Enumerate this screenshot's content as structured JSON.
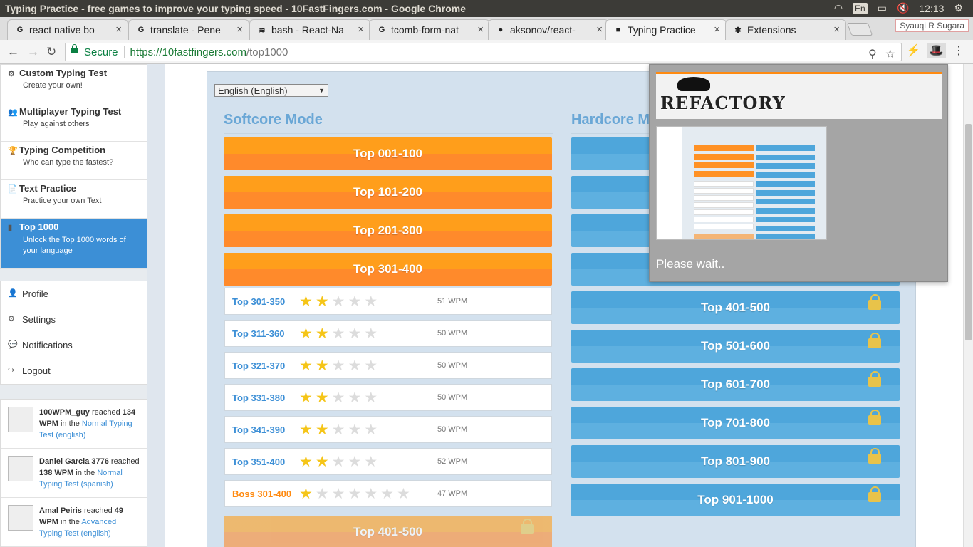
{
  "os": {
    "title": "Typing Practice - free games to improve your typing speed - 10FastFingers.com - Google Chrome",
    "lang": "En",
    "time": "12:13"
  },
  "tabs": [
    {
      "label": "react native bo",
      "fav": "G"
    },
    {
      "label": "translate - Pene",
      "fav": "G"
    },
    {
      "label": "bash - React-Na",
      "fav": "≋"
    },
    {
      "label": "tcomb-form-nat",
      "fav": "G"
    },
    {
      "label": "aksonov/react-",
      "fav": "●"
    },
    {
      "label": "Typing Practice",
      "fav": "■"
    },
    {
      "label": "Extensions",
      "fav": "✱"
    }
  ],
  "tab_close": "×",
  "user": "Syauqi R Sugara",
  "omnibox": {
    "secure": "Secure",
    "scheme": "https://",
    "host": "10fastfingers.com",
    "path": "/top1000"
  },
  "nav": {
    "back": "←",
    "forward": "→",
    "reload": "↻",
    "zoom": "⚲",
    "star": "☆",
    "menu": "⋮"
  },
  "sidebar": {
    "menu": [
      {
        "title": "Custom Typing Test",
        "sub": "Create your own!",
        "icon": "⚙"
      },
      {
        "title": "Multiplayer Typing Test",
        "sub": "Play against others",
        "icon": "👥"
      },
      {
        "title": "Typing Competition",
        "sub": "Who can type the fastest?",
        "icon": "🏆"
      },
      {
        "title": "Text Practice",
        "sub": "Practice your own Text",
        "icon": "📄"
      },
      {
        "title": "Top 1000",
        "sub": "Unlock the Top 1000 words of your language",
        "icon": "▮"
      }
    ],
    "account": [
      {
        "label": "Profile",
        "icon": "👤"
      },
      {
        "label": "Settings",
        "icon": "⚙"
      },
      {
        "label": "Notifications",
        "icon": "💬"
      },
      {
        "label": "Logout",
        "icon": "↪"
      }
    ],
    "feed": [
      {
        "name": "100WPM_guy",
        "pre": " reached ",
        "wpm": "134",
        "unit": " WPM",
        "mid": " in the ",
        "link": "Normal Typing Test (english)"
      },
      {
        "name": "Daniel Garcia 3776",
        "pre": " reached ",
        "wpm": "138",
        "unit": " WPM",
        "mid": " in the ",
        "link": "Normal Typing Test (spanish)"
      },
      {
        "name": "Amal Peiris",
        "pre": " reached ",
        "wpm": "49",
        "unit": " WPM",
        "mid": " in the ",
        "link": "Advanced Typing Test (english)"
      }
    ]
  },
  "main": {
    "language": "English (English)",
    "softcore_title": "Softcore Mode",
    "hardcore_title": "Hardcore M",
    "softcore_buttons": [
      "Top 001-100",
      "Top 101-200",
      "Top 201-300",
      "Top 301-400"
    ],
    "rows": [
      {
        "label": "Top 301-350",
        "stars": 2,
        "total": 5,
        "wpm": "51 WPM"
      },
      {
        "label": "Top 311-360",
        "stars": 2,
        "total": 5,
        "wpm": "50 WPM"
      },
      {
        "label": "Top 321-370",
        "stars": 2,
        "total": 5,
        "wpm": "50 WPM"
      },
      {
        "label": "Top 331-380",
        "stars": 2,
        "total": 5,
        "wpm": "50 WPM"
      },
      {
        "label": "Top 341-390",
        "stars": 2,
        "total": 5,
        "wpm": "50 WPM"
      },
      {
        "label": "Top 351-400",
        "stars": 2,
        "total": 5,
        "wpm": "52 WPM"
      },
      {
        "label": "Boss 301-400",
        "stars": 1,
        "total": 7,
        "wpm": "47 WPM",
        "boss": true
      }
    ],
    "softcore_locked": "Top 401-500",
    "hardcore_buttons": [
      "Top 401-500",
      "Top 501-600",
      "Top 601-700",
      "Top 701-800",
      "Top 801-900",
      "Top 901-1000"
    ]
  },
  "popup": {
    "logo": "REFACTORY",
    "status": "Please wait.."
  },
  "colors": {
    "orange": "#ff9124",
    "blue": "#4ea6db",
    "active": "#3c8fd6"
  }
}
